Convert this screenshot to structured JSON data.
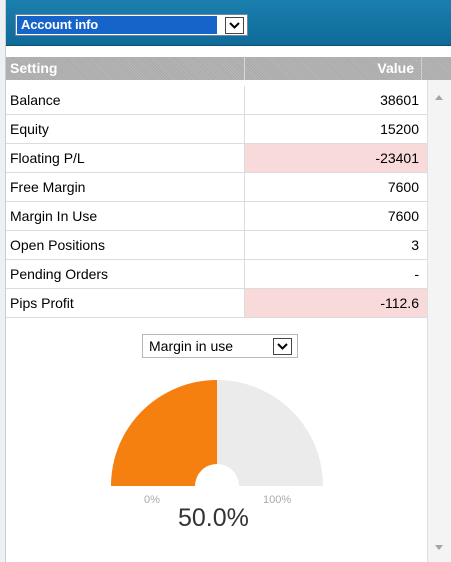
{
  "account_select": {
    "value": "Account info",
    "icon": "chevron-down-icon"
  },
  "table": {
    "headers": {
      "setting": "Setting",
      "value": "Value"
    },
    "rows": [
      {
        "setting": "Balance",
        "value": "38601",
        "negative": false
      },
      {
        "setting": "Equity",
        "value": "15200",
        "negative": false
      },
      {
        "setting": "Floating P/L",
        "value": "-23401",
        "negative": true
      },
      {
        "setting": "Free Margin",
        "value": "7600",
        "negative": false
      },
      {
        "setting": "Margin In Use",
        "value": "7600",
        "negative": false
      },
      {
        "setting": "Open Positions",
        "value": "3",
        "negative": false
      },
      {
        "setting": "Pending Orders",
        "value": "-",
        "negative": false
      },
      {
        "setting": "Pips Profit",
        "value": "-112.6",
        "negative": true
      }
    ]
  },
  "gauge": {
    "select_value": "Margin in use",
    "min_label": "0%",
    "max_label": "100%",
    "value_text": "50.0%",
    "fraction": 0.5,
    "fill_color": "#f57f0f",
    "track_color": "#ebebeb"
  },
  "colors": {
    "top_bar": "#1677a6",
    "negative_bg": "#f9dada",
    "selected_bg": "#1664c9"
  }
}
